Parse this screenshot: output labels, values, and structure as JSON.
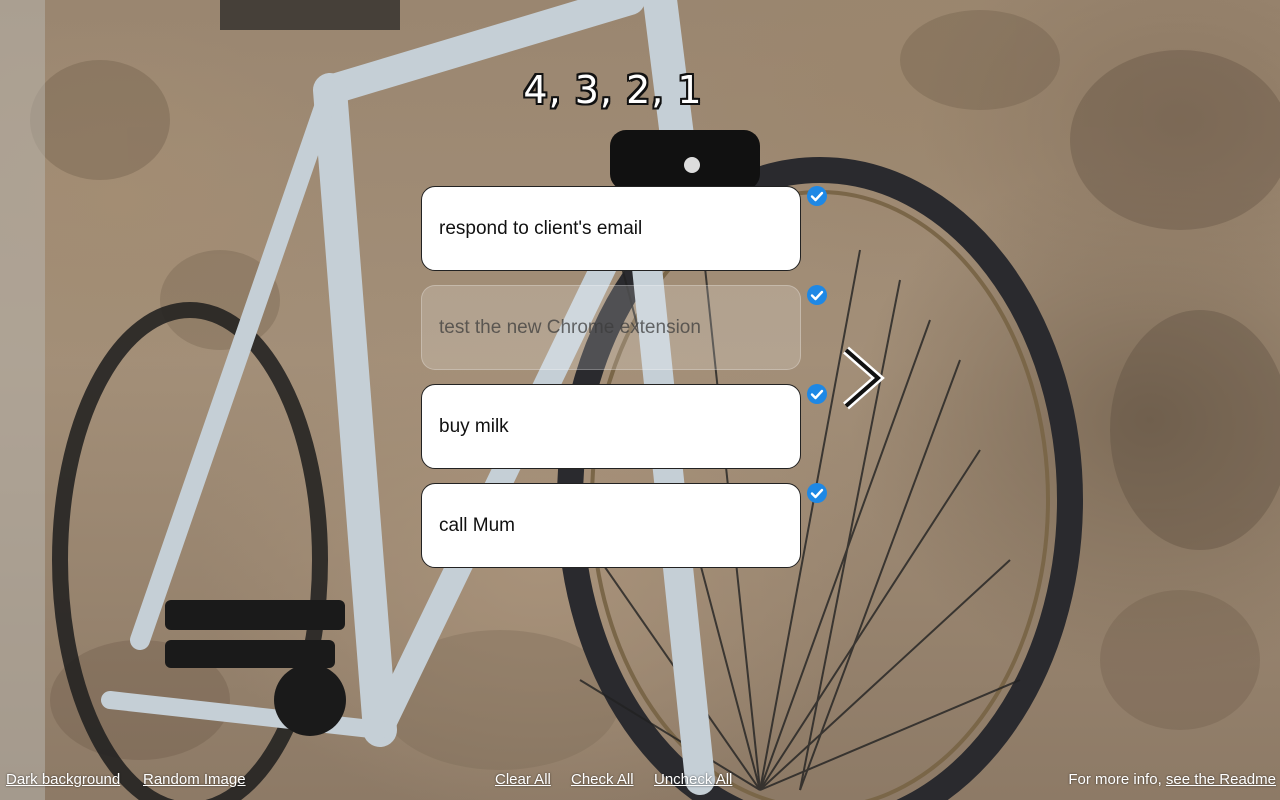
{
  "heading": "4, 3, 2, 1",
  "tasks": [
    {
      "text": "respond to client's email",
      "done": false
    },
    {
      "text": "test the new Chrome extension",
      "done": true
    },
    {
      "text": "buy milk",
      "done": false
    },
    {
      "text": "call Mum",
      "done": false
    }
  ],
  "icons": {
    "check": "check-circle-icon",
    "next": "chevron-right-icon"
  },
  "colors": {
    "check_badge": "#1e88e5",
    "card": "#ffffff"
  },
  "footer": {
    "dark_background": "Dark background",
    "random_image": "Random Image",
    "clear_all": "Clear All",
    "check_all": "Check All",
    "uncheck_all": "Uncheck All",
    "info_prefix": "For more info,",
    "readme_link": "see the Readme"
  }
}
